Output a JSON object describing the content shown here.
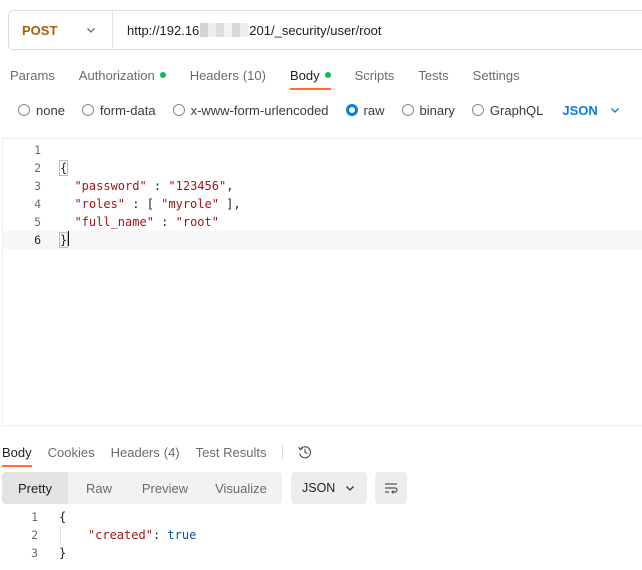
{
  "request": {
    "method": "POST",
    "url_prefix": "http://192.16",
    "url_suffix": "201/_security/user/root"
  },
  "request_tabs": [
    {
      "label": "Params"
    },
    {
      "label": "Authorization",
      "dot": true
    },
    {
      "label": "Headers",
      "count": "(10)"
    },
    {
      "label": "Body",
      "dot": true,
      "active": true
    },
    {
      "label": "Scripts"
    },
    {
      "label": "Tests"
    },
    {
      "label": "Settings"
    }
  ],
  "body_types": [
    {
      "label": "none"
    },
    {
      "label": "form-data"
    },
    {
      "label": "x-www-form-urlencoded"
    },
    {
      "label": "raw",
      "selected": true
    },
    {
      "label": "binary"
    },
    {
      "label": "GraphQL"
    }
  ],
  "body_format": "JSON",
  "request_body": {
    "line_numbers": [
      "1",
      "2",
      "3",
      "4",
      "5",
      "6"
    ],
    "open_brace": "{",
    "close_brace": "}",
    "k_password": "\"password\"",
    "v_password": "\"123456\"",
    "k_roles": "\"roles\"",
    "v_roles": "\"myrole\"",
    "k_full_name": "\"full_name\"",
    "v_full_name": "\"root\""
  },
  "response_tabs": [
    {
      "label": "Body",
      "active": true
    },
    {
      "label": "Cookies"
    },
    {
      "label": "Headers",
      "count": "(4)"
    },
    {
      "label": "Test Results"
    }
  ],
  "view_modes": [
    {
      "label": "Pretty",
      "active": true
    },
    {
      "label": "Raw"
    },
    {
      "label": "Preview"
    },
    {
      "label": "Visualize"
    }
  ],
  "response_format": "JSON",
  "response_body": {
    "line_numbers": [
      "1",
      "2",
      "3"
    ],
    "open_brace": "{",
    "key": "\"created\"",
    "value": "true",
    "close_brace": "}"
  },
  "colors": {
    "method": "#a3620a",
    "accent_tab": "#ff6c37",
    "status_dot": "#0cbb52",
    "selection_blue": "#097bed"
  },
  "icons": {
    "method_dropdown": "chevron-down-icon",
    "format_dropdown": "chevron-down-icon",
    "history": "history-icon",
    "wrap": "wrap-lines-icon"
  }
}
